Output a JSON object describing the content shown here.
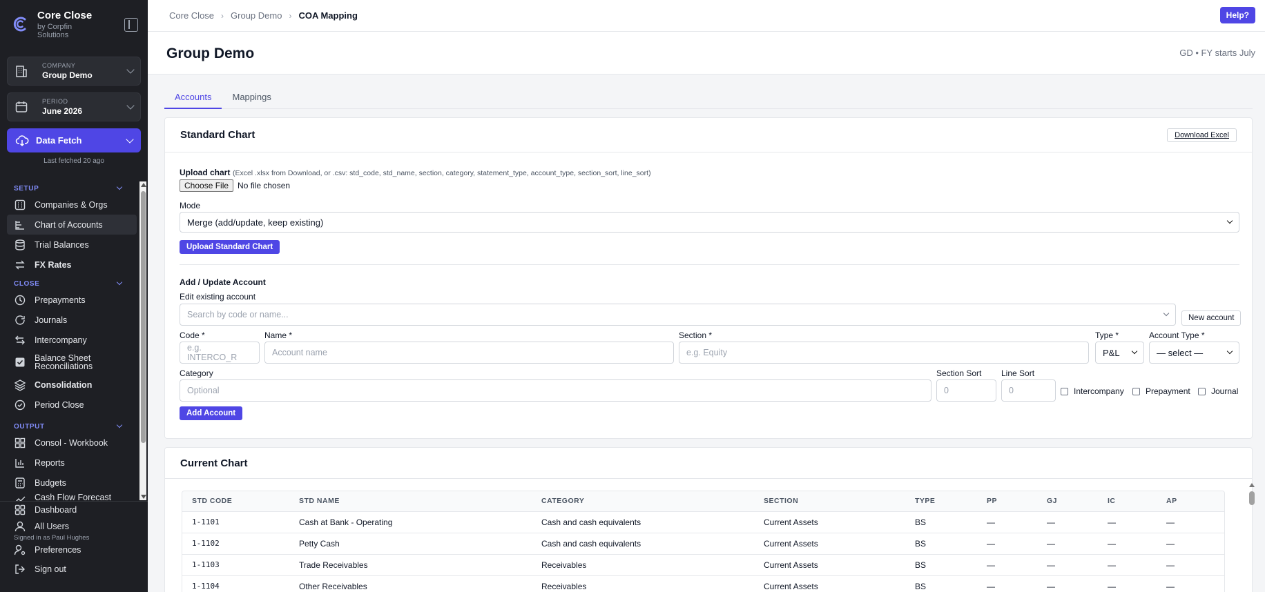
{
  "brand": {
    "title": "Core Close",
    "subtitle": "by Corpfin Solutions"
  },
  "company": {
    "label": "COMPANY",
    "value": "Group Demo"
  },
  "period": {
    "label": "PERIOD",
    "value": "June 2026"
  },
  "data_fetch": {
    "label": "Data Fetch",
    "last_fetched": "Last fetched 20 ago"
  },
  "nav": {
    "setup": {
      "title": "SETUP",
      "items": [
        "Companies & Orgs",
        "Chart of Accounts",
        "Trial Balances",
        "FX Rates"
      ]
    },
    "close": {
      "title": "CLOSE",
      "items": [
        "Prepayments",
        "Journals",
        "Intercompany",
        "Balance Sheet Reconciliations",
        "Consolidation",
        "Period Close"
      ]
    },
    "output": {
      "title": "OUTPUT",
      "items": [
        "Consol - Workbook",
        "Reports",
        "Budgets",
        "Cash Flow Forecast"
      ]
    }
  },
  "bottom_nav": {
    "dashboard": "Dashboard",
    "all_users": "All Users",
    "signed_in": "Signed in as Paul Hughes",
    "preferences": "Preferences",
    "sign_out": "Sign out"
  },
  "breadcrumb": [
    "Core Close",
    "Group Demo",
    "COA Mapping"
  ],
  "help_label": "Help?",
  "page": {
    "title": "Group Demo",
    "meta": "GD • FY starts July"
  },
  "tabs": [
    "Accounts",
    "Mappings"
  ],
  "standard_chart": {
    "title": "Standard Chart",
    "download_label": "Download Excel",
    "upload_label": "Upload chart",
    "upload_hint": "(Excel .xlsx from Download, or .csv: std_code, std_name, section, category, statement_type, account_type, section_sort, line_sort)",
    "choose_file": "Choose File",
    "no_file": "No file chosen",
    "mode_label": "Mode",
    "mode_value": "Merge (add/update, keep existing)",
    "upload_button": "Upload Standard Chart",
    "add_update_title": "Add / Update Account",
    "edit_existing_label": "Edit existing account",
    "search_placeholder": "Search by code or name...",
    "new_account": "New account",
    "code_label": "Code *",
    "code_placeholder": "e.g. INTERCO_R",
    "name_label": "Name *",
    "name_placeholder": "Account name",
    "section_label": "Section *",
    "section_placeholder": "e.g. Equity",
    "type_label": "Type *",
    "type_value": "P&L",
    "account_type_label": "Account Type *",
    "account_type_value": "— select —",
    "category_label": "Category",
    "category_placeholder": "Optional",
    "section_sort_label": "Section Sort",
    "section_sort_placeholder": "0",
    "line_sort_label": "Line Sort",
    "line_sort_placeholder": "0",
    "checkboxes": [
      "Intercompany",
      "Prepayment",
      "Journal"
    ],
    "add_button": "Add Account"
  },
  "current_chart": {
    "title": "Current Chart",
    "columns": [
      "STD CODE",
      "STD NAME",
      "CATEGORY",
      "SECTION",
      "TYPE",
      "PP",
      "GJ",
      "IC",
      "AP"
    ],
    "rows": [
      [
        "1-1101",
        "Cash at Bank - Operating",
        "Cash and cash equivalents",
        "Current Assets",
        "BS",
        "—",
        "—",
        "—",
        "—"
      ],
      [
        "1-1102",
        "Petty Cash",
        "Cash and cash equivalents",
        "Current Assets",
        "BS",
        "—",
        "—",
        "—",
        "—"
      ],
      [
        "1-1103",
        "Trade Receivables",
        "Receivables",
        "Current Assets",
        "BS",
        "—",
        "—",
        "—",
        "—"
      ],
      [
        "1-1104",
        "Other Receivables",
        "Receivables",
        "Current Assets",
        "BS",
        "—",
        "—",
        "—",
        "—"
      ]
    ]
  },
  "colors": {
    "accent": "#4f46e5",
    "sidebar_bg": "#1e1f24",
    "section_label": "#818cf8"
  }
}
